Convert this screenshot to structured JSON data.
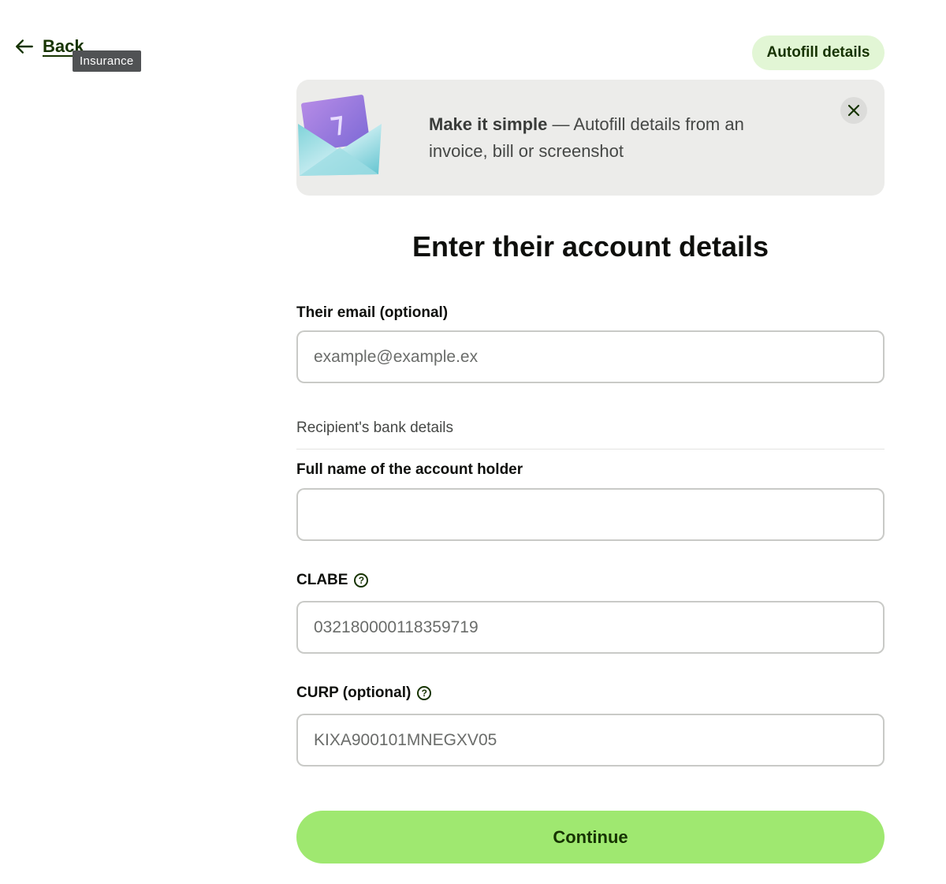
{
  "nav": {
    "back_label": "Back",
    "tooltip": "Insurance"
  },
  "header": {
    "autofill_label": "Autofill details"
  },
  "banner": {
    "headline": "Make it simple",
    "body": " — Autofill details from an invoice, bill or screenshot"
  },
  "page": {
    "title": "Enter their account details"
  },
  "form": {
    "email": {
      "label": "Their email (optional)",
      "placeholder": "example@example.ex",
      "value": ""
    },
    "section_label": "Recipient's bank details",
    "full_name": {
      "label": "Full name of the account holder",
      "placeholder": "",
      "value": ""
    },
    "clabe": {
      "label": "CLABE",
      "placeholder": "032180000118359719",
      "value": ""
    },
    "curp": {
      "label": "CURP (optional)",
      "placeholder": "KIXA900101MNEGXV05",
      "value": ""
    },
    "help_glyph": "?"
  },
  "footer": {
    "continue_label": "Continue"
  },
  "colors": {
    "accent": "#9fe870",
    "accent_light": "#e2f6d5",
    "forest": "#163300",
    "banner_bg": "#ececea"
  },
  "icons": [
    "arrow-left-icon",
    "close-icon",
    "help-icon",
    "envelope-illustration"
  ]
}
